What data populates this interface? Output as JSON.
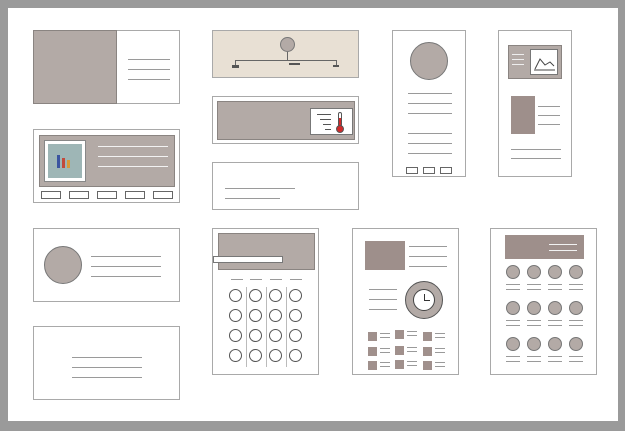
{
  "canvas": {
    "background": "#ffffff",
    "frame_color": "#9a9a9a",
    "accent_fill": "#b3aaa6",
    "dark_fill": "#9e8f8b",
    "header_fill": "#e8e0d4"
  },
  "cards": [
    {
      "name": "image-text-card",
      "icon": "image-placeholder"
    },
    {
      "name": "timeline-card",
      "icon": "timeline-icon"
    },
    {
      "name": "profile-column-card",
      "icon": "avatar-circle"
    },
    {
      "name": "chart-thumbnail-card",
      "icon": "line-chart-icon"
    },
    {
      "name": "bar-chart-card",
      "icon": "bar-chart-icon"
    },
    {
      "name": "thermometer-card",
      "icon": "thermometer-icon"
    },
    {
      "name": "text-only-card",
      "icon": ""
    },
    {
      "name": "avatar-row-card",
      "icon": "avatar-circle"
    },
    {
      "name": "plain-text-card",
      "icon": ""
    },
    {
      "name": "calculator-card",
      "icon": "keypad-icon"
    },
    {
      "name": "clock-card",
      "icon": "clock-icon"
    },
    {
      "name": "dot-grid-card",
      "icon": "dot-grid-icon"
    }
  ]
}
